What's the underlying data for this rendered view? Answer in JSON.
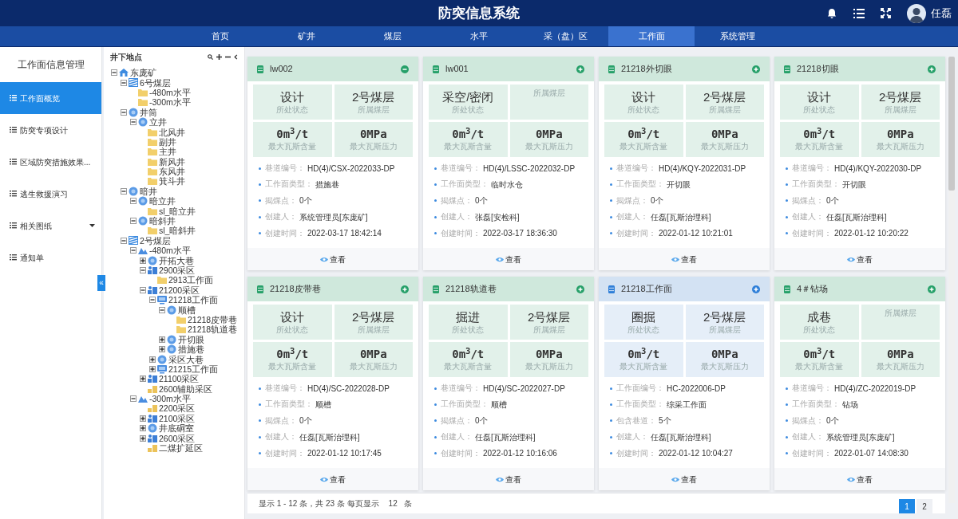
{
  "header": {
    "title": "防突信息系统",
    "user": "任磊"
  },
  "nav": [
    {
      "label": "首页",
      "selected": false
    },
    {
      "label": "矿井",
      "selected": false
    },
    {
      "label": "煤层",
      "selected": false
    },
    {
      "label": "水平",
      "selected": false
    },
    {
      "label": "采（盘）区",
      "selected": false
    },
    {
      "label": "工作面",
      "selected": true
    },
    {
      "label": "系统管理",
      "selected": false
    }
  ],
  "sidebar": {
    "title": "工作面信息管理",
    "items": [
      {
        "label": "工作面概览",
        "selected": true,
        "has_submenu": false
      },
      {
        "label": "防突专项设计",
        "selected": false,
        "has_submenu": false
      },
      {
        "label": "区域防突措施效果...",
        "selected": false,
        "has_submenu": false
      },
      {
        "label": "逃生救援演习",
        "selected": false,
        "has_submenu": false
      },
      {
        "label": "相关图纸",
        "selected": false,
        "has_submenu": true
      },
      {
        "label": "通知单",
        "selected": false,
        "has_submenu": false
      }
    ],
    "collapse_button": "«"
  },
  "tree": {
    "title": "井下地点",
    "nodes": [
      {
        "label": "东庞矿",
        "kind": "mine",
        "expanded": true,
        "children": [
          {
            "label": "6号煤层",
            "kind": "seam",
            "expanded": true,
            "children": [
              {
                "label": "-480m水平",
                "kind": "folder"
              },
              {
                "label": "-300m水平",
                "kind": "folder"
              }
            ]
          },
          {
            "label": "井筒",
            "kind": "node",
            "expanded": true,
            "children": [
              {
                "label": "立井",
                "kind": "node",
                "expanded": true,
                "children": [
                  {
                    "label": "北风井",
                    "kind": "folder"
                  },
                  {
                    "label": "副井",
                    "kind": "folder"
                  },
                  {
                    "label": "主井",
                    "kind": "folder"
                  },
                  {
                    "label": "新风井",
                    "kind": "folder"
                  },
                  {
                    "label": "东风井",
                    "kind": "folder"
                  },
                  {
                    "label": "箕斗井",
                    "kind": "folder"
                  }
                ]
              }
            ]
          },
          {
            "label": "暗井",
            "kind": "node",
            "expanded": true,
            "children": [
              {
                "label": "暗立井",
                "kind": "node",
                "expanded": true,
                "children": [
                  {
                    "label": "sl_暗立井",
                    "kind": "folder"
                  }
                ]
              },
              {
                "label": "暗斜井",
                "kind": "node",
                "expanded": true,
                "children": [
                  {
                    "label": "sl_暗斜井",
                    "kind": "folder"
                  }
                ]
              }
            ]
          },
          {
            "label": "2号煤层",
            "kind": "seam",
            "expanded": true,
            "children": [
              {
                "label": "-480m水平",
                "kind": "level",
                "expanded": true,
                "children": [
                  {
                    "label": "开拓大巷",
                    "kind": "node",
                    "expanded": false
                  },
                  {
                    "label": "2900采区",
                    "kind": "area",
                    "expanded": true,
                    "children": [
                      {
                        "label": "2913工作面",
                        "kind": "folder"
                      }
                    ]
                  },
                  {
                    "label": "21200采区",
                    "kind": "area",
                    "expanded": true,
                    "children": [
                      {
                        "label": "21218工作面",
                        "kind": "face",
                        "expanded": true,
                        "children": [
                          {
                            "label": "顺槽",
                            "kind": "node",
                            "expanded": true,
                            "children": [
                              {
                                "label": "21218皮带巷",
                                "kind": "folder"
                              },
                              {
                                "label": "21218轨道巷",
                                "kind": "folder"
                              }
                            ]
                          },
                          {
                            "label": "开切眼",
                            "kind": "node",
                            "expanded": false
                          },
                          {
                            "label": "措施巷",
                            "kind": "node",
                            "expanded": false
                          }
                        ]
                      },
                      {
                        "label": "采区大巷",
                        "kind": "node",
                        "expanded": false
                      },
                      {
                        "label": "21215工作面",
                        "kind": "face",
                        "expanded": false
                      }
                    ]
                  },
                  {
                    "label": "21100采区",
                    "kind": "area",
                    "expanded": false
                  },
                  {
                    "label": "2600辅助采区",
                    "kind": "area_leaf"
                  }
                ]
              },
              {
                "label": "-300m水平",
                "kind": "level",
                "expanded": true,
                "children": [
                  {
                    "label": "2200采区",
                    "kind": "area_leaf"
                  },
                  {
                    "label": "2100采区",
                    "kind": "area",
                    "expanded": false
                  },
                  {
                    "label": "井底硐室",
                    "kind": "node",
                    "expanded": false
                  },
                  {
                    "label": "2600采区",
                    "kind": "area",
                    "expanded": false
                  },
                  {
                    "label": "二煤扩延区",
                    "kind": "area_leaf"
                  }
                ]
              }
            ]
          }
        ]
      }
    ]
  },
  "cards": [
    {
      "title": "lw002",
      "color": "#cfe8dc",
      "expanded": true,
      "status": {
        "value": "设计",
        "label": "所处状态"
      },
      "seam": {
        "value": "2号煤层",
        "label": "所属煤层"
      },
      "gas": {
        "value": "0m$^{3}$/t",
        "label": "最大瓦斯含量"
      },
      "pressure": {
        "value": "0MPa",
        "label": "最大瓦斯压力"
      },
      "details": [
        {
          "label": "巷道编号：",
          "value": "HD(4)/CSX-2022033-DP"
        },
        {
          "label": "工作面类型：",
          "value": "措施巷"
        },
        {
          "label": "揭煤点：",
          "value": "0个"
        },
        {
          "label": "创建人：",
          "value": "系统管理员[东庞矿]"
        },
        {
          "label": "创建时间：",
          "value": "2022-03-17 18:42:14"
        }
      ],
      "view": "查看"
    },
    {
      "title": "lw001",
      "color": "#cfe8dc",
      "expanded": false,
      "status": {
        "value": "采空/密闭",
        "label": "所处状态"
      },
      "seam": {
        "label": "所属煤层"
      },
      "gas": {
        "value": "0m$^{3}$/t",
        "label": "最大瓦斯含量"
      },
      "pressure": {
        "value": "0MPa",
        "label": "最大瓦斯压力"
      },
      "details": [
        {
          "label": "巷道编号：",
          "value": "HD(4)/LSSC-2022032-DP"
        },
        {
          "label": "工作面类型：",
          "value": "临时水仓"
        },
        {
          "label": "揭煤点：",
          "value": "0个"
        },
        {
          "label": "创建人：",
          "value": "张磊[安检科]"
        },
        {
          "label": "创建时间：",
          "value": "2022-03-17 18:36:30"
        }
      ],
      "view": "查看"
    },
    {
      "title": "21218外切眼",
      "color": "#cfe8dc",
      "expanded": false,
      "status": {
        "value": "设计",
        "label": "所处状态"
      },
      "seam": {
        "value": "2号煤层",
        "label": "所属煤层"
      },
      "gas": {
        "value": "0m$^{3}$/t",
        "label": "最大瓦斯含量"
      },
      "pressure": {
        "value": "0MPa",
        "label": "最大瓦斯压力"
      },
      "details": [
        {
          "label": "巷道编号：",
          "value": "HD(4)/KQY-2022031-DP"
        },
        {
          "label": "工作面类型：",
          "value": "开切眼"
        },
        {
          "label": "揭煤点：",
          "value": "0个"
        },
        {
          "label": "创建人：",
          "value": "任磊[瓦斯治理科]"
        },
        {
          "label": "创建时间：",
          "value": "2022-01-12 10:21:01"
        }
      ],
      "view": "查看"
    },
    {
      "title": "21218切眼",
      "color": "#cfe8dc",
      "expanded": false,
      "status": {
        "value": "设计",
        "label": "所处状态"
      },
      "seam": {
        "value": "2号煤层",
        "label": "所属煤层"
      },
      "gas": {
        "value": "0m$^{3}$/t",
        "label": "最大瓦斯含量"
      },
      "pressure": {
        "value": "0MPa",
        "label": "最大瓦斯压力"
      },
      "details": [
        {
          "label": "巷道编号：",
          "value": "HD(4)/KQY-2022030-DP"
        },
        {
          "label": "工作面类型：",
          "value": "开切眼"
        },
        {
          "label": "揭煤点：",
          "value": "0个"
        },
        {
          "label": "创建人：",
          "value": "任磊[瓦斯治理科]"
        },
        {
          "label": "创建时间：",
          "value": "2022-01-12 10:20:22"
        }
      ],
      "view": "查看"
    },
    {
      "title": "21218皮带巷",
      "color": "#cfe8dc",
      "expanded": false,
      "status": {
        "value": "设计",
        "label": "所处状态"
      },
      "seam": {
        "value": "2号煤层",
        "label": "所属煤层"
      },
      "gas": {
        "value": "0m$^{3}$/t",
        "label": "最大瓦斯含量"
      },
      "pressure": {
        "value": "0MPa",
        "label": "最大瓦斯压力"
      },
      "details": [
        {
          "label": "巷道编号：",
          "value": "HD(4)/SC-2022028-DP"
        },
        {
          "label": "工作面类型：",
          "value": "顺槽"
        },
        {
          "label": "揭煤点：",
          "value": "0个"
        },
        {
          "label": "创建人：",
          "value": "任磊[瓦斯治理科]"
        },
        {
          "label": "创建时间：",
          "value": "2022-01-12 10:17:45"
        }
      ],
      "view": "查看"
    },
    {
      "title": "21218轨道巷",
      "color": "#cfe8dc",
      "expanded": false,
      "status": {
        "value": "掘进",
        "label": "所处状态"
      },
      "seam": {
        "value": "2号煤层",
        "label": "所属煤层"
      },
      "gas": {
        "value": "0m$^{3}$/t",
        "label": "最大瓦斯含量"
      },
      "pressure": {
        "value": "0MPa",
        "label": "最大瓦斯压力"
      },
      "details": [
        {
          "label": "巷道编号：",
          "value": "HD(4)/SC-2022027-DP"
        },
        {
          "label": "工作面类型：",
          "value": "顺槽"
        },
        {
          "label": "揭煤点：",
          "value": "0个"
        },
        {
          "label": "创建人：",
          "value": "任磊[瓦斯治理科]"
        },
        {
          "label": "创建时间：",
          "value": "2022-01-12 10:16:06"
        }
      ],
      "view": "查看"
    },
    {
      "title": "21218工作面",
      "color": "#d3e2f3",
      "expanded": false,
      "status": {
        "value": "圈掘",
        "label": "所处状态"
      },
      "seam": {
        "value": "2号煤层",
        "label": "所属煤层"
      },
      "gas": {
        "value": "0m$^{3}$/t",
        "label": "最大瓦斯含量"
      },
      "pressure": {
        "value": "0MPa",
        "label": "最大瓦斯压力"
      },
      "details": [
        {
          "label": "工作面编号：",
          "value": "HC-2022006-DP"
        },
        {
          "label": "工作面类型：",
          "value": "综采工作面"
        },
        {
          "label": "包含巷道：",
          "value": "5个"
        },
        {
          "label": "创建人：",
          "value": "任磊[瓦斯治理科]"
        },
        {
          "label": "创建时间：",
          "value": "2022-01-12 10:04:27"
        }
      ],
      "view": "查看"
    },
    {
      "title": "4＃钻场",
      "color": "#cfe8dc",
      "expanded": false,
      "status": {
        "value": "成巷",
        "label": "所处状态"
      },
      "seam": {
        "label": "所属煤层"
      },
      "gas": {
        "value": "0m$^{3}$/t",
        "label": "最大瓦斯含量"
      },
      "pressure": {
        "value": "0MPa",
        "label": "最大瓦斯压力"
      },
      "details": [
        {
          "label": "巷道编号：",
          "value": "HD(4)/ZC-2022019-DP"
        },
        {
          "label": "工作面类型：",
          "value": "钻场"
        },
        {
          "label": "揭煤点：",
          "value": "0个"
        },
        {
          "label": "创建人：",
          "value": "系统管理员[东庞矿]"
        },
        {
          "label": "创建时间：",
          "value": "2022-01-07 14:08:30"
        }
      ],
      "view": "查看"
    }
  ],
  "footer": {
    "summary": "显示 1 - 12 条，共 23 条 每页显示",
    "page_size": "12",
    "unit": "条",
    "pages": [
      {
        "label": "1",
        "selected": true
      },
      {
        "label": "2",
        "selected": false
      }
    ]
  }
}
